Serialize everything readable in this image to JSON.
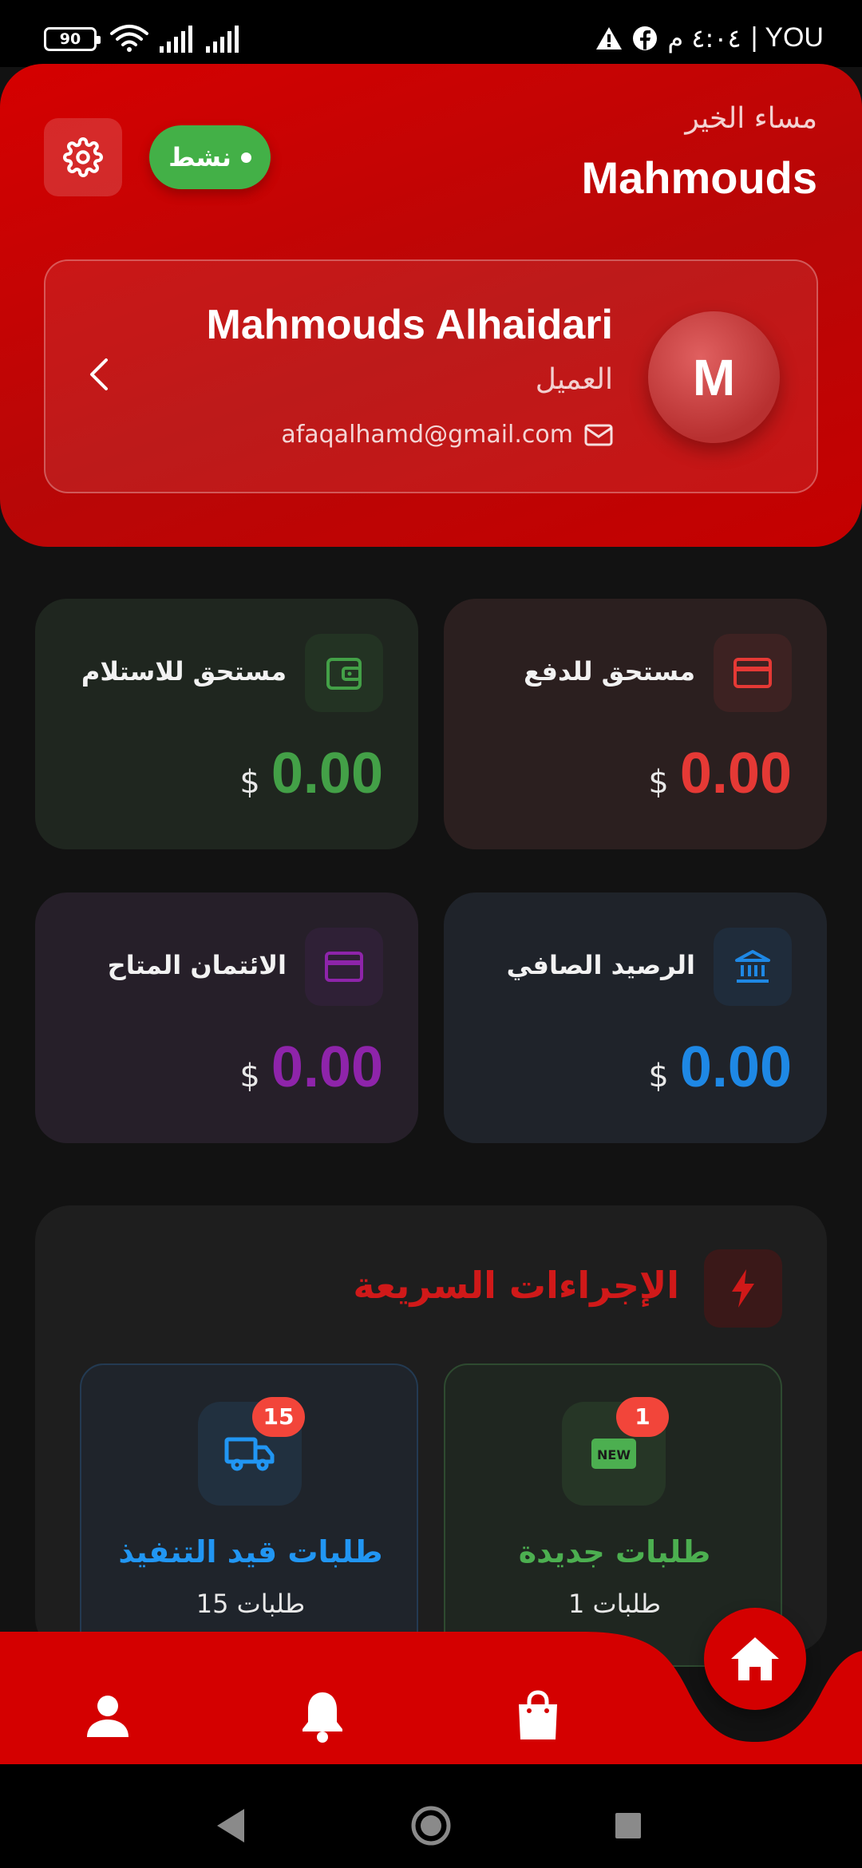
{
  "status_bar": {
    "battery": "90",
    "carrier": "YOU",
    "time": "٤:٠٤ م",
    "icons": [
      "wifi-icon",
      "signal-icon",
      "signal-icon",
      "alert-icon",
      "facebook-icon"
    ]
  },
  "header": {
    "greeting": "مساء الخير",
    "username": "Mahmouds",
    "status_label": "نشط",
    "profile": {
      "avatar_letter": "M",
      "full_name": "Mahmouds Alhaidari",
      "role": "العميل",
      "email": "afaqalhamd@gmail.com"
    }
  },
  "stats": [
    {
      "label": "مستحق للدفع",
      "value": "0.00",
      "currency": "$",
      "color": "#e53935",
      "icon": "credit-card-icon"
    },
    {
      "label": "مستحق للاستلام",
      "value": "0.00",
      "currency": "$",
      "color": "#43a047",
      "icon": "wallet-icon"
    },
    {
      "label": "الرصيد الصافي",
      "value": "0.00",
      "currency": "$",
      "color": "#1e88e5",
      "icon": "bank-icon"
    },
    {
      "label": "الائتمان المتاح",
      "value": "0.00",
      "currency": "$",
      "color": "#8e24aa",
      "icon": "credit-card-icon"
    }
  ],
  "quick_actions": {
    "title": "الإجراءات السريعة",
    "items": [
      {
        "title": "طلبات جديدة",
        "subtitle": "1 طلبات",
        "badge": "1",
        "icon": "new-badge-icon",
        "color": "#4caf50"
      },
      {
        "title": "طلبات قيد التنفيذ",
        "subtitle": "15 طلبات",
        "badge": "15",
        "icon": "truck-icon",
        "color": "#2196f3"
      }
    ]
  },
  "bottom_nav": {
    "items": [
      "profile-icon",
      "bell-icon",
      "shopping-bag-icon",
      "home-icon"
    ],
    "accent": "#d40000"
  },
  "colors": {
    "brand": "#d50000",
    "background": "#121212",
    "active_green": "#43b047"
  }
}
